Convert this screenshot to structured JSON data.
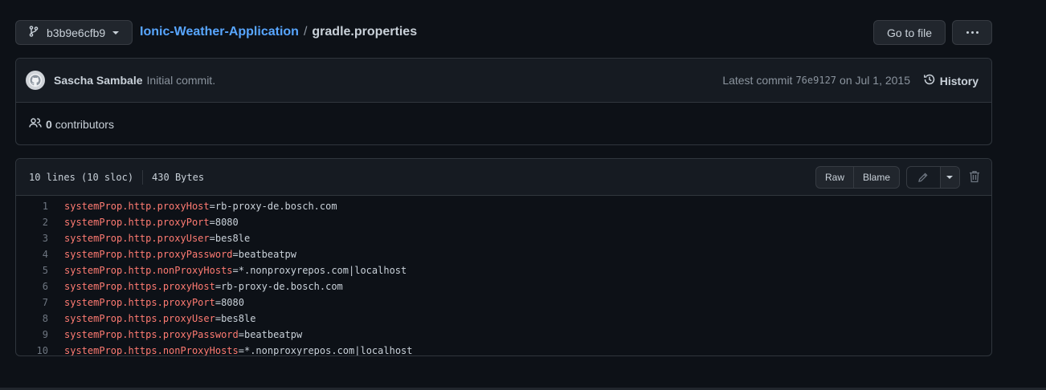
{
  "branch": {
    "label": "b3b9e6cfb9"
  },
  "breadcrumb": {
    "repo": "Ionic-Weather-Application",
    "separator": "/",
    "file": "gradle.properties"
  },
  "actions": {
    "goto_file": "Go to file"
  },
  "commit": {
    "author": "Sascha Sambale",
    "message": "Initial commit.",
    "latest_prefix": "Latest commit",
    "sha": "76e9127",
    "date": "on Jul 1, 2015",
    "history_label": "History"
  },
  "contributors": {
    "count": "0",
    "label": "contributors"
  },
  "file": {
    "lines_info": "10 lines (10 sloc)",
    "size": "430 Bytes",
    "raw_label": "Raw",
    "blame_label": "Blame"
  },
  "code_lines": [
    {
      "num": "1",
      "key": "systemProp.http.proxyHost",
      "value": "=rb-proxy-de.bosch.com"
    },
    {
      "num": "2",
      "key": "systemProp.http.proxyPort",
      "value": "=8080"
    },
    {
      "num": "3",
      "key": "systemProp.http.proxyUser",
      "value": "=bes8le"
    },
    {
      "num": "4",
      "key": "systemProp.http.proxyPassword",
      "value": "=beatbeatpw"
    },
    {
      "num": "5",
      "key": "systemProp.http.nonProxyHosts",
      "value": "=*.nonproxyrepos.com|localhost"
    },
    {
      "num": "6",
      "key": "systemProp.https.proxyHost",
      "value": "=rb-proxy-de.bosch.com"
    },
    {
      "num": "7",
      "key": "systemProp.https.proxyPort",
      "value": "=8080"
    },
    {
      "num": "8",
      "key": "systemProp.https.proxyUser",
      "value": "=bes8le"
    },
    {
      "num": "9",
      "key": "systemProp.https.proxyPassword",
      "value": "=beatbeatpw"
    },
    {
      "num": "10",
      "key": "systemProp.https.nonProxyHosts",
      "value": "=*.nonproxyrepos.com|localhost"
    }
  ],
  "colors": {
    "background": "#0d1117",
    "link": "#58a6ff",
    "code_key": "#ff7b72",
    "border": "#30363d"
  },
  "icons": [
    "git-branch-icon",
    "chevron-down-icon",
    "kebab-icon",
    "history-icon",
    "people-icon",
    "pencil-icon",
    "trash-icon"
  ]
}
